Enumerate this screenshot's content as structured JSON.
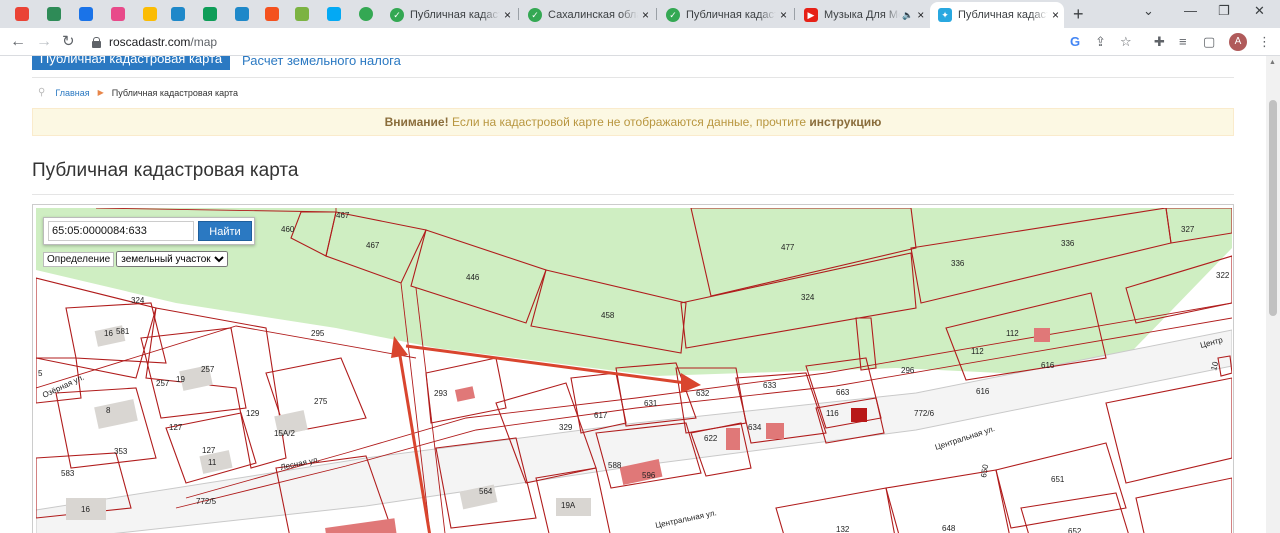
{
  "browser": {
    "tabs": [
      {
        "title": "Публичная кадастр",
        "active": false
      },
      {
        "title": "Сахалинская облас",
        "active": false
      },
      {
        "title": "Публичная кадастр",
        "active": false
      },
      {
        "title": "Музыка Для Мо",
        "active": false
      },
      {
        "title": "Публичная кадастр",
        "active": true
      }
    ],
    "url_host": "roscadastr.com",
    "url_path": "/map",
    "avatar_letter": "A"
  },
  "nav": {
    "primary_button": "Публичная кадастровая карта",
    "tax_link": "Расчет земельного налога"
  },
  "breadcrumb": {
    "home": "Главная",
    "current": "Публичная кадастровая карта"
  },
  "alert": {
    "strong": "Внимание!",
    "text": " Если на кадастровой карте не отображаются данные, прочтите ",
    "link": "инструкцию"
  },
  "page_title": "Публичная кадастровая карта",
  "map": {
    "search_value": "65:05:0000084:633",
    "find_button": "Найти",
    "definition_label": "Определение",
    "definition_selected": "земельный участок",
    "labels": [
      "467",
      "460",
      "467",
      "295",
      "477",
      "336",
      "336",
      "327",
      "322",
      "446",
      "458",
      "324",
      "324",
      "16",
      "581",
      "295",
      "112",
      "112",
      "616",
      "616",
      "5",
      "257",
      "19",
      "257",
      "8",
      "129",
      "275",
      "293",
      "617",
      "631",
      "632",
      "633",
      "663",
      "116",
      "296",
      "772/6",
      "127",
      "15А/2",
      "329",
      "622",
      "634",
      "353",
      "127",
      "11",
      "Лесная ул.",
      "588",
      "596",
      "Центральная ул.",
      "583",
      "772/5",
      "16",
      "564",
      "19А",
      "132",
      "648",
      "651",
      "652",
      "650",
      "Центральная ул.",
      "Озёрная ул.",
      "Центр",
      "10"
    ]
  }
}
